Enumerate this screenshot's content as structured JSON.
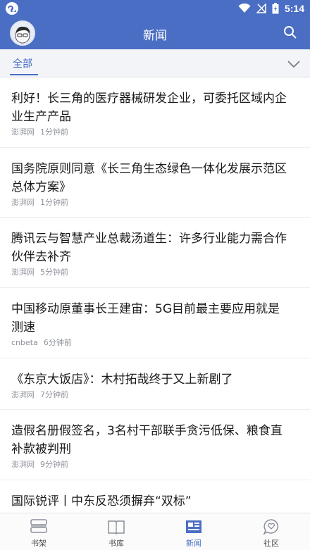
{
  "status_bar": {
    "time": "5:14"
  },
  "header": {
    "title": "新闻"
  },
  "tabs": {
    "active": "全部"
  },
  "news": [
    {
      "title": "利好！长三角的医疗器械研发企业，可委托区域内企业生产产品",
      "source": "澎湃网",
      "time": "1分钟前"
    },
    {
      "title": "国务院原则同意《长三角生态绿色一体化发展示范区总体方案》",
      "source": "澎湃网",
      "time": "1分钟前"
    },
    {
      "title": "腾讯云与智慧产业总裁汤道生：许多行业能力需合作伙伴去补齐",
      "source": "澎湃网",
      "time": "5分钟前"
    },
    {
      "title": "中国移动原董事长王建宙：5G目前最主要应用就是测速",
      "source": "cnbeta",
      "time": "6分钟前"
    },
    {
      "title": "《东京大饭店》：木村拓哉终于又上新剧了",
      "source": "澎湃网",
      "time": "7分钟前"
    },
    {
      "title": "造假名册假签名，3名村干部联手贪污低保、粮食直补款被判刑",
      "source": "澎湃网",
      "time": "9分钟前"
    },
    {
      "title": "国际锐评丨中东反恐须摒弃“双标”",
      "source": "",
      "time": ""
    }
  ],
  "bottom_nav": [
    {
      "label": "书架",
      "icon": "bookshelf-icon"
    },
    {
      "label": "书库",
      "icon": "library-icon"
    },
    {
      "label": "新闻",
      "icon": "news-icon",
      "active": true
    },
    {
      "label": "社区",
      "icon": "community-icon"
    }
  ],
  "colors": {
    "primary": "#4a6ec3"
  }
}
